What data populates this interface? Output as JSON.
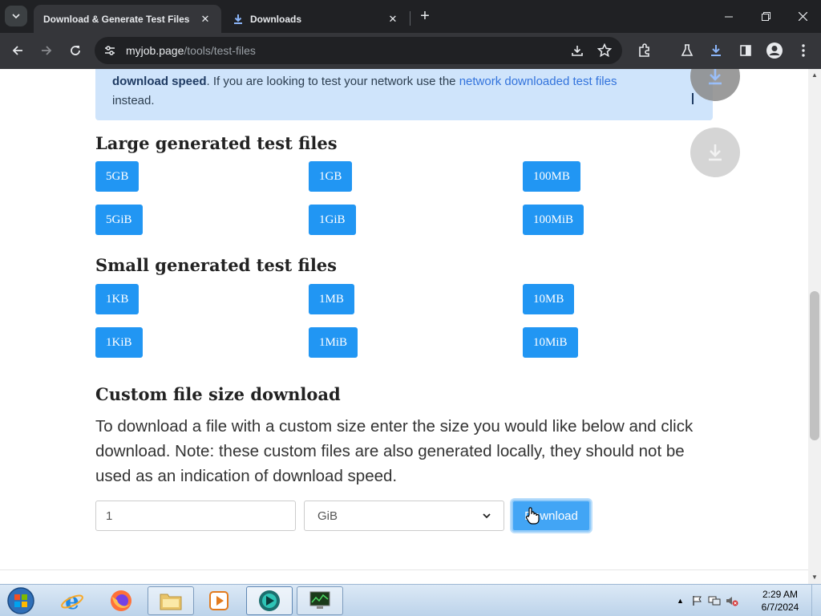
{
  "browser": {
    "tabs": [
      {
        "title": "Download & Generate Test Files",
        "active": true
      },
      {
        "title": "Downloads",
        "active": false
      }
    ],
    "address": {
      "domain": "myjob.page",
      "path": "/tools/test-files"
    }
  },
  "notice": {
    "bold": "download speed",
    "text_before_link": ". If you are looking to test your network use the ",
    "link": "network downloaded test files",
    "text_after": "instead."
  },
  "large_section": {
    "heading": "Large generated test files",
    "buttons": [
      "5GB",
      "1GB",
      "100MB",
      "5GiB",
      "1GiB",
      "100MiB"
    ]
  },
  "small_section": {
    "heading": "Small generated test files",
    "buttons": [
      "1KB",
      "1MB",
      "10MB",
      "1KiB",
      "1MiB",
      "10MiB"
    ]
  },
  "custom": {
    "heading": "Custom file size download",
    "description": "To download a file with a custom size enter the size you would like below and click download. Note: these custom files are also generated locally, they should not be used as an indication of download speed.",
    "size_value": "1",
    "unit_selected": "GiB",
    "download_label": "Download"
  },
  "taskbar": {
    "time": "2:29 AM",
    "date": "6/7/2024"
  },
  "colors": {
    "button_blue": "#2196f3",
    "notice_bg": "#cfe4fb",
    "chrome_dark": "#202124"
  }
}
